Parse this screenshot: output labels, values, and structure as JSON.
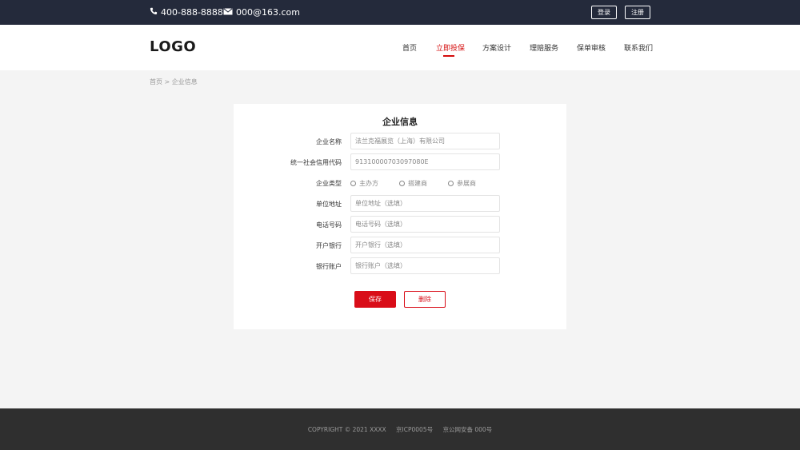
{
  "topbar": {
    "phone": "400-888-8888",
    "email": "000@163.com",
    "login_label": "登录",
    "register_label": "注册",
    "bg_color": "#242a3b"
  },
  "header": {
    "logo": "LOGO",
    "nav": [
      {
        "label": "首页"
      },
      {
        "label": "立即投保",
        "active": true
      },
      {
        "label": "方案设计"
      },
      {
        "label": "理赔服务"
      },
      {
        "label": "保单审核"
      },
      {
        "label": "联系我们"
      }
    ]
  },
  "breadcrumb": {
    "home": "首页",
    "separator": ">",
    "current": "企业信息"
  },
  "form": {
    "title": "企业信息",
    "company_name_label": "企业名称",
    "company_name_value": "法兰克福展览（上海）有限公司",
    "credit_code_label": "统一社会信用代码",
    "credit_code_value": "91310000703097080E",
    "type_label": "企业类型",
    "type_options": [
      "主办方",
      "搭建商",
      "参展商"
    ],
    "address_label": "单位地址",
    "address_placeholder": "单位地址（选填）",
    "phone_label": "电话号码",
    "phone_placeholder": "电话号码（选填）",
    "bank_label": "开户银行",
    "bank_placeholder": "开户银行（选填）",
    "account_label": "银行账户",
    "account_placeholder": "银行账户（选填）",
    "save_label": "保存",
    "delete_label": "删除",
    "accent_color": "#d90d18"
  },
  "footer": {
    "copyright": "COPYRIGHT © 2021 XXXX",
    "icp": "京ICP0005号",
    "police": "京公网安备 000号"
  }
}
